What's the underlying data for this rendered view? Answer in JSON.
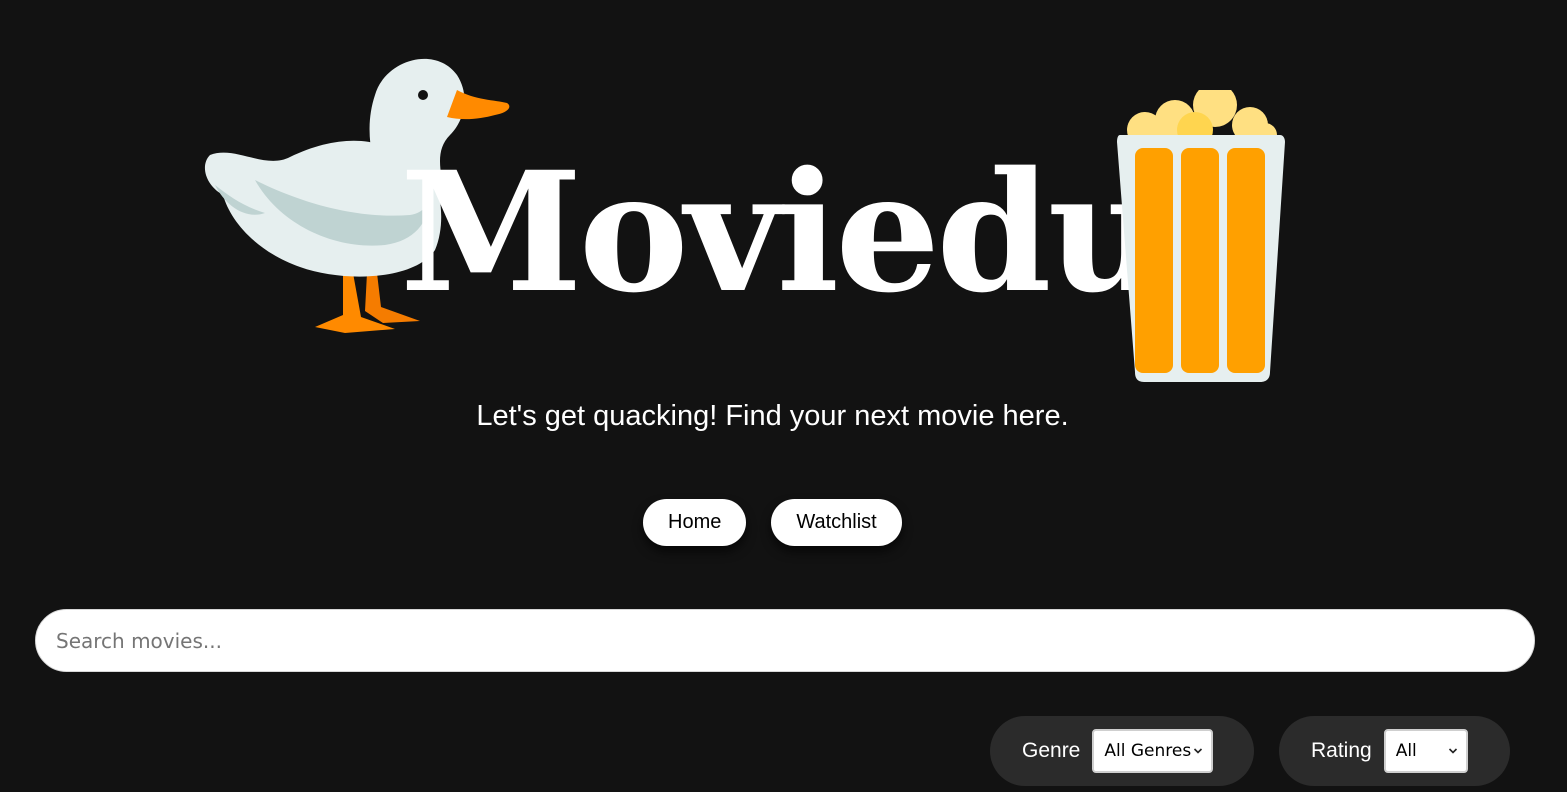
{
  "brand": {
    "name": "Moviedux",
    "tagline": "Let's get quacking! Find your next movie here."
  },
  "nav": {
    "home_label": "Home",
    "watchlist_label": "Watchlist"
  },
  "search": {
    "placeholder": "Search movies...",
    "value": ""
  },
  "filters": {
    "genre": {
      "label": "Genre",
      "selected": "All Genres"
    },
    "rating": {
      "label": "Rating",
      "selected": "All"
    }
  },
  "icons": {
    "logo_left": "duck-icon",
    "logo_right": "popcorn-icon",
    "select_arrow": "chevron-down-icon"
  },
  "colors": {
    "background": "#121212",
    "filter_pill": "#2b2b2b",
    "popcorn_orange": "#FFA000",
    "duck_beak": "#FF8A00"
  }
}
